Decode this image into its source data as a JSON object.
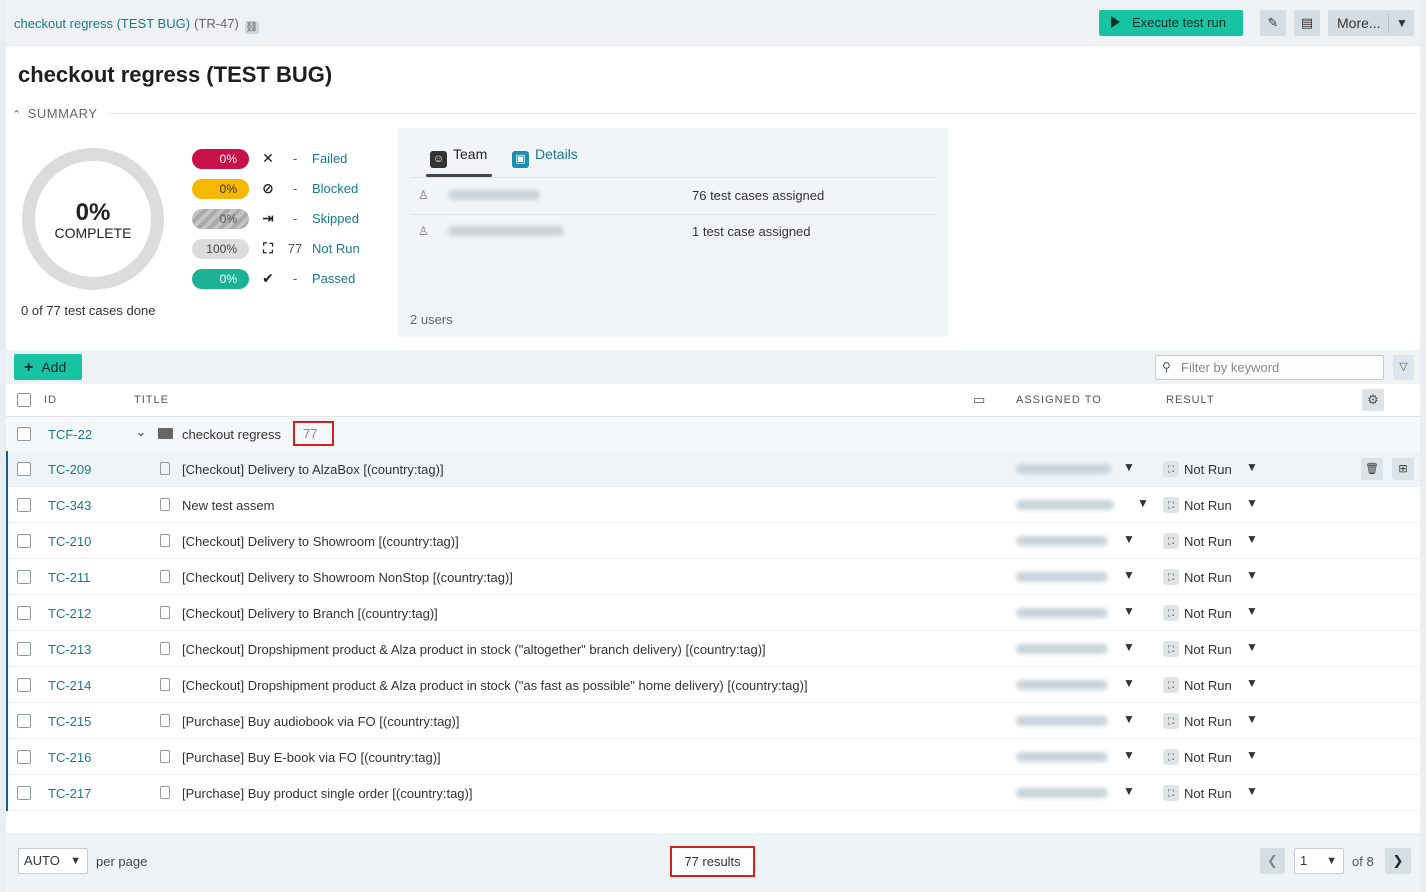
{
  "header": {
    "breadcrumb": "checkout regress (TEST BUG)",
    "run_id": "(TR-47)",
    "execute_label": "Execute test run",
    "more_label": "More..."
  },
  "page_title": "checkout regress (TEST BUG)",
  "summary": {
    "heading": "SUMMARY",
    "complete_pct": "0%",
    "complete_label": "COMPLETE",
    "done_text": "0 of 77 test cases done",
    "stats": [
      {
        "pct": "0%",
        "count": "-",
        "label": "Failed",
        "color": "#c8104a",
        "icon": "x-icon"
      },
      {
        "pct": "0%",
        "count": "-",
        "label": "Blocked",
        "color": "#f5b800",
        "icon": "blocked-icon"
      },
      {
        "pct": "0%",
        "count": "-",
        "label": "Skipped",
        "color": "#a9a9a9",
        "icon": "skip-icon"
      },
      {
        "pct": "100%",
        "count": "77",
        "label": "Not Run",
        "color": "#dcdcdc",
        "icon": "not-run-icon"
      },
      {
        "pct": "0%",
        "count": "-",
        "label": "Passed",
        "color": "#1bb394",
        "icon": "check-icon"
      }
    ]
  },
  "team_panel": {
    "tab_team": "Team",
    "tab_details": "Details",
    "rows": [
      {
        "assigned": "76 test cases assigned"
      },
      {
        "assigned": "1 test case assigned"
      }
    ],
    "users_count": "2 users"
  },
  "toolbar": {
    "add_label": "Add",
    "filter_placeholder": "Filter by keyword"
  },
  "table": {
    "headers": {
      "id": "ID",
      "title": "TITLE",
      "assigned": "ASSIGNED TO",
      "result": "RESULT"
    },
    "group": {
      "id": "TCF-22",
      "title": "checkout regress",
      "count": "77"
    },
    "rows": [
      {
        "id": "TC-209",
        "title": "[Checkout] Delivery to AlzaBox [(country:tag)]",
        "result": "Not Run"
      },
      {
        "id": "TC-343",
        "title": "New test assem",
        "result": "Not Run"
      },
      {
        "id": "TC-210",
        "title": "[Checkout] Delivery to Showroom [(country:tag)]",
        "result": "Not Run"
      },
      {
        "id": "TC-211",
        "title": "[Checkout] Delivery to Showroom NonStop [(country:tag)]",
        "result": "Not Run"
      },
      {
        "id": "TC-212",
        "title": "[Checkout] Delivery to Branch [(country:tag)]",
        "result": "Not Run"
      },
      {
        "id": "TC-213",
        "title": "[Checkout] Dropshipment product & Alza product in stock (\"altogether\" branch delivery) [(country:tag)]",
        "result": "Not Run"
      },
      {
        "id": "TC-214",
        "title": "[Checkout] Dropshipment product & Alza product in stock (\"as fast as possible\" home delivery) [(country:tag)]",
        "result": "Not Run"
      },
      {
        "id": "TC-215",
        "title": "[Purchase] Buy audiobook via FO [(country:tag)]",
        "result": "Not Run"
      },
      {
        "id": "TC-216",
        "title": "[Purchase] Buy E-book via FO [(country:tag)]",
        "result": "Not Run"
      },
      {
        "id": "TC-217",
        "title": "[Purchase] Buy product single order [(country:tag)]",
        "result": "Not Run"
      }
    ]
  },
  "footer": {
    "per_page_value": "AUTO",
    "per_page_label": "per page",
    "results": "77 results",
    "page": "1",
    "of_pages": "of 8"
  }
}
